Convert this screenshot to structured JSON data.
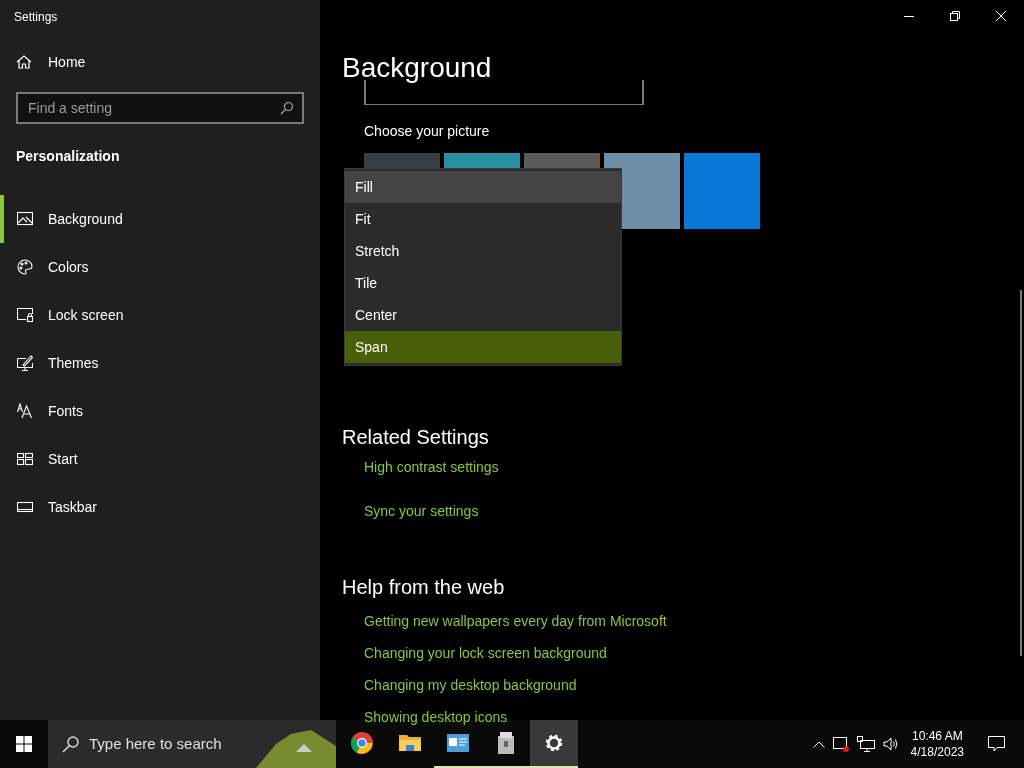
{
  "window": {
    "title": "Settings"
  },
  "sidebar": {
    "home": "Home",
    "search": {
      "placeholder": "Find a setting"
    },
    "section": "Personalization",
    "items": [
      {
        "label": "Background",
        "kind": "picture",
        "selected": true
      },
      {
        "label": "Colors",
        "kind": "palette",
        "selected": false
      },
      {
        "label": "Lock screen",
        "kind": "lock",
        "selected": false
      },
      {
        "label": "Themes",
        "kind": "themes",
        "selected": false
      },
      {
        "label": "Fonts",
        "kind": "fonts",
        "selected": false
      },
      {
        "label": "Start",
        "kind": "start",
        "selected": false
      },
      {
        "label": "Taskbar",
        "kind": "taskbar",
        "selected": false
      }
    ]
  },
  "main": {
    "title": "Background",
    "picture_heading": "Choose your picture",
    "pictures": [
      {
        "color": "#3a3d44"
      },
      {
        "color": "#2a8fa0"
      },
      {
        "color": "#5a5a5a"
      },
      {
        "color": "#6f8fa8"
      },
      {
        "color": "#0a78d7"
      }
    ],
    "fit_menu": [
      {
        "label": "Fill",
        "hovered": true,
        "selected": false
      },
      {
        "label": "Fit",
        "hovered": false,
        "selected": false
      },
      {
        "label": "Stretch",
        "hovered": false,
        "selected": false
      },
      {
        "label": "Tile",
        "hovered": false,
        "selected": false
      },
      {
        "label": "Center",
        "hovered": false,
        "selected": false
      },
      {
        "label": "Span",
        "hovered": false,
        "selected": true
      }
    ],
    "related": {
      "title": "Related Settings",
      "links": [
        "High contrast settings",
        "Sync your settings"
      ]
    },
    "help": {
      "title": "Help from the web",
      "links": [
        "Getting new wallpapers every day from Microsoft",
        "Changing your lock screen background",
        "Changing my desktop background",
        "Showing desktop icons"
      ]
    }
  },
  "taskbar": {
    "search_placeholder": "Type here to search",
    "apps": [
      {
        "kind": "browser",
        "running": false,
        "active": false
      },
      {
        "kind": "folder",
        "running": false,
        "active": false
      },
      {
        "kind": "app",
        "running": true,
        "active": false
      },
      {
        "kind": "archive",
        "running": true,
        "active": false
      },
      {
        "kind": "settings",
        "running": true,
        "active": true
      }
    ],
    "time": "10:46 AM",
    "date": "4/18/2023"
  }
}
